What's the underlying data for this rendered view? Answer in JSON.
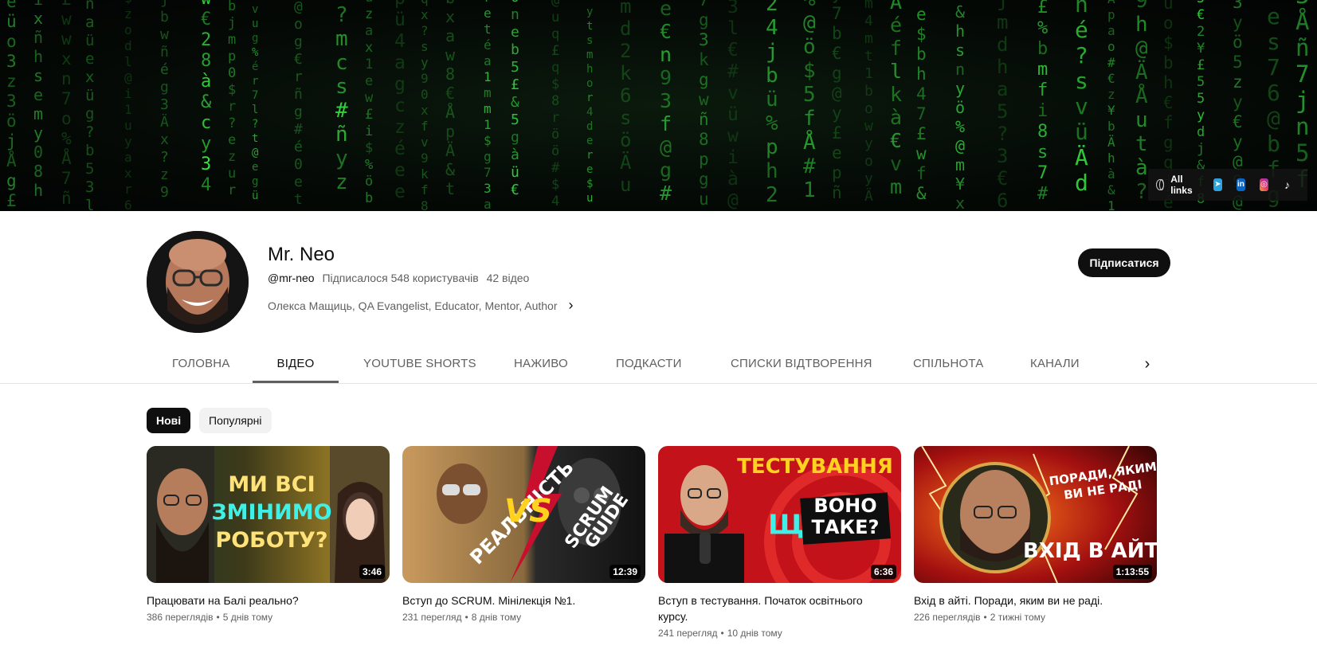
{
  "banner": {
    "links_label": "All links",
    "social_icons": [
      "telegram-icon",
      "linkedin-icon",
      "instagram-icon",
      "tiktok-icon"
    ]
  },
  "channel": {
    "name": "Mr. Neo",
    "handle": "@mr-neo",
    "subscribers": "Підписалося 548 користувачів",
    "video_count": "42 відео",
    "description": "Олекса Мащиць, QA Evangelist, Educator, Mentor, Author",
    "subscribe_label": "Підписатися"
  },
  "tabs": [
    {
      "label": "ГОЛОВНА",
      "active": false
    },
    {
      "label": "ВІДЕО",
      "active": true
    },
    {
      "label": "YOUTUBE SHORTS",
      "active": false
    },
    {
      "label": "НАЖИВО",
      "active": false
    },
    {
      "label": "ПОДКАСТИ",
      "active": false
    },
    {
      "label": "СПИСКИ ВІДТВОРЕННЯ",
      "active": false
    },
    {
      "label": "СПІЛЬНОТА",
      "active": false
    },
    {
      "label": "КАНАЛИ",
      "active": false
    }
  ],
  "chips": [
    {
      "label": "Нові",
      "selected": true
    },
    {
      "label": "Популярні",
      "selected": false
    }
  ],
  "videos": [
    {
      "title": "Працювати на Балі реально?",
      "views": "386 переглядів",
      "age": "5 днів тому",
      "duration": "3:46",
      "thumb_text": [
        "МИ ВСІ",
        "ЗМІНИМО",
        "РОБОТУ?"
      ]
    },
    {
      "title": "Вступ до SCRUM. Мінілекція №1.",
      "views": "231 перегляд",
      "age": "8 днів тому",
      "duration": "12:39",
      "thumb_text": [
        "РЕАЛЬНІСТЬ",
        "VS",
        "SCRUM",
        "GUIDE"
      ]
    },
    {
      "title": "Вступ в тестування. Початок освітнього курсу.",
      "views": "241 перегляд",
      "age": "10 днів тому",
      "duration": "6:36",
      "thumb_text": [
        "ТЕСТУВАННЯ",
        "ЩО",
        "ВОНО",
        "ТАКЕ?"
      ]
    },
    {
      "title": "Вхід в айті. Поради, яким ви не раді.",
      "views": "226 переглядів",
      "age": "2 тижні тому",
      "duration": "1:13:55",
      "thumb_text": [
        "ПОРАДИ, ЯКИМ",
        "ВИ НЕ РАДІ",
        "ВХІД В АЙТІ"
      ]
    }
  ]
}
